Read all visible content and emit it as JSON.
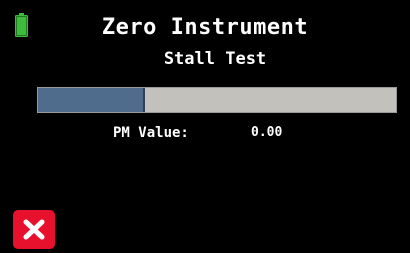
{
  "status": {
    "battery_icon": "battery-icon",
    "battery_color": "#3dbb3d"
  },
  "header": {
    "title": "Zero Instrument",
    "subtitle": "Stall Test"
  },
  "progress": {
    "fraction": 0.3,
    "fill_color": "#4f6c8c",
    "track_color": "#c3c1bc"
  },
  "reading": {
    "label": "PM Value:",
    "value": "0.00"
  },
  "actions": {
    "close_icon": "close-icon",
    "close_color": "#e8112d"
  }
}
